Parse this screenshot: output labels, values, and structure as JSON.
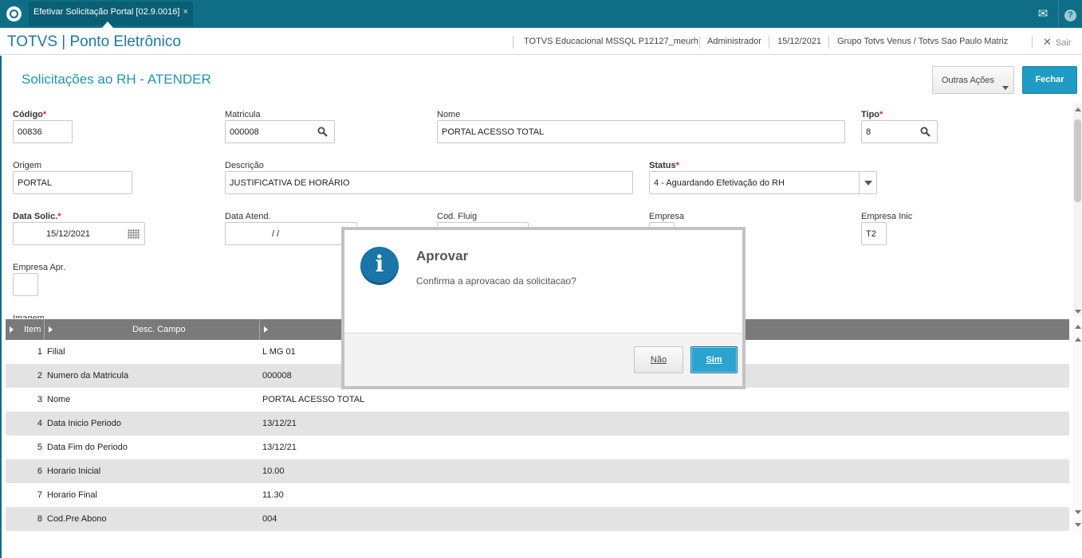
{
  "topbar": {
    "tab_label": "Efetivar Solicitação Portal [02.9.0016]",
    "tab_close": "×",
    "mail_icon": "✉",
    "help_icon": "?"
  },
  "header": {
    "app_title": "TOTVS | Ponto Eletrônico",
    "environment": "TOTVS Educacional MSSQL P12127_meurh",
    "user": "Administrador",
    "date": "15/12/2021",
    "company": "Grupo Totvs Venus / Totvs Sao Paulo Matriz",
    "exit_label": "Sair",
    "exit_icon": "✕"
  },
  "page": {
    "title": "Solicitações ao RH - ATENDER",
    "outras_acoes": "Outras Ações",
    "fechar": "Fechar"
  },
  "form": {
    "codigo": {
      "label": "Código",
      "value": "00836"
    },
    "matricula": {
      "label": "Matricula",
      "value": "000008"
    },
    "nome": {
      "label": "Nome",
      "value": "PORTAL ACESSO TOTAL"
    },
    "tipo": {
      "label": "Tipo",
      "value": "8"
    },
    "origem": {
      "label": "Origem",
      "value": "PORTAL"
    },
    "descricao": {
      "label": "Descrição",
      "value": "JUSTIFICATIVA DE HORÁRIO"
    },
    "status": {
      "label": "Status",
      "value": "4 - Aguardando Efetivação do RH"
    },
    "data_solic": {
      "label": "Data Solic.",
      "value": "15/12/2021"
    },
    "data_atend": {
      "label": "Data Atend.",
      "value": "/ /"
    },
    "cod_fluig": {
      "label": "Cod. Fluig",
      "value": ""
    },
    "empresa": {
      "label": "Empresa",
      "value": ""
    },
    "empresa_inic": {
      "label": "Empresa Inic",
      "value": "T2"
    },
    "empresa_apr": {
      "label": "Empresa Apr.",
      "value": ""
    },
    "imagem": {
      "label": "Imagem"
    },
    "required_mark": "*"
  },
  "grid": {
    "columns": [
      "Item",
      "Desc. Campo",
      ""
    ],
    "rows": [
      {
        "num": "1",
        "desc": "Filial",
        "value": "L MG 01"
      },
      {
        "num": "2",
        "desc": "Numero da Matricula",
        "value": "000008"
      },
      {
        "num": "3",
        "desc": "Nome",
        "value": "PORTAL ACESSO TOTAL"
      },
      {
        "num": "4",
        "desc": "Data Inicio Periodo",
        "value": "13/12/21"
      },
      {
        "num": "5",
        "desc": "Data Fim do Periodo",
        "value": "13/12/21"
      },
      {
        "num": "6",
        "desc": "Horario Inicial",
        "value": "10.00"
      },
      {
        "num": "7",
        "desc": "Horario Final",
        "value": "11.30"
      },
      {
        "num": "8",
        "desc": "Cod.Pre Abono",
        "value": "004"
      }
    ]
  },
  "dialog": {
    "title": "Aprovar",
    "message": "Confirma a aprovacao da solicitacao?",
    "icon": "i",
    "no_label": "Não",
    "yes_label": "Sim"
  }
}
